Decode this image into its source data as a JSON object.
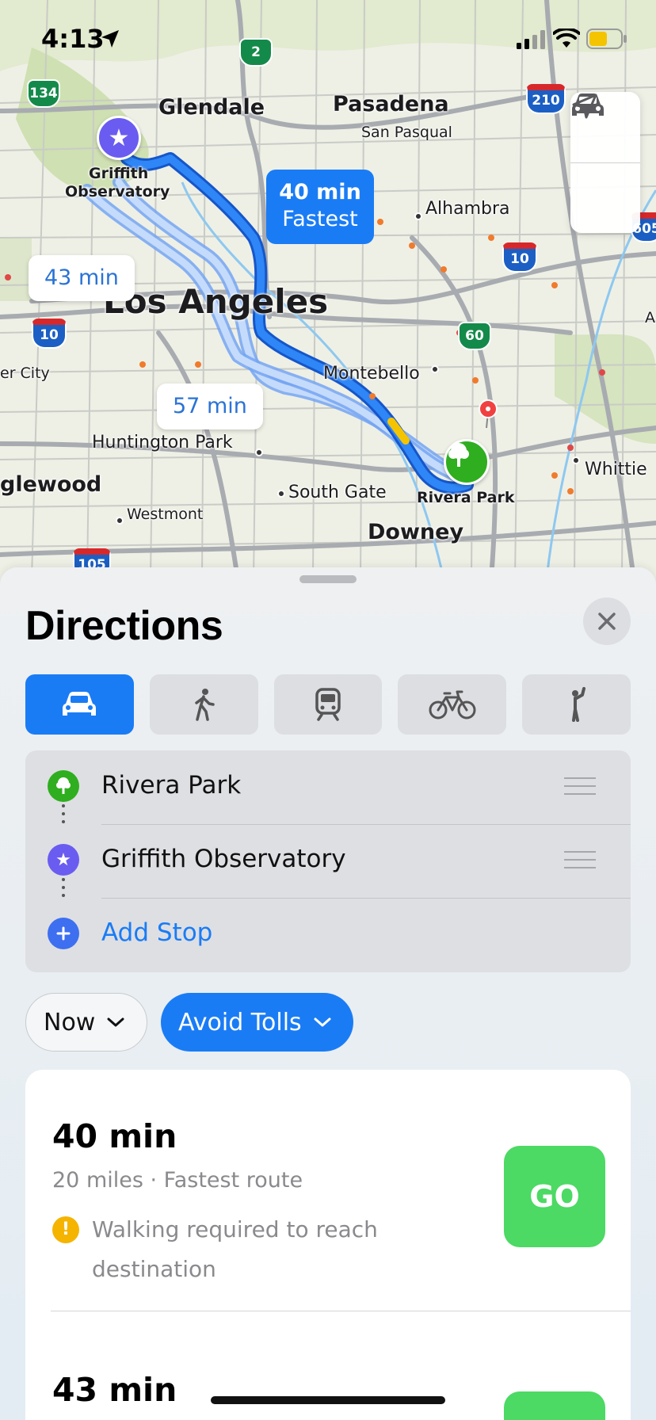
{
  "status_bar": {
    "time": "4:13"
  },
  "map": {
    "cities": {
      "glendale": "Glendale",
      "pasadena": "Pasadena",
      "san_pasqual": "San Pasqual",
      "griffith": "Griffith",
      "observatory": "Observatory",
      "alhambra": "Alhambra",
      "los_angeles": "Los Angeles",
      "montebello": "Montebello",
      "culver_city": "er City",
      "huntington_park": "Huntington Park",
      "inglewood": "glewood",
      "south_gate": "South Gate",
      "rivera_park": "Rivera Park",
      "westmont": "Westmont",
      "downey": "Downey",
      "whittier": "Whittie",
      "edge_a": "A"
    },
    "highways": [
      "134",
      "2",
      "210",
      "10",
      "10",
      "60",
      "605",
      "105"
    ],
    "routes": {
      "fastest_time": "40 min",
      "fastest_label": "Fastest",
      "alt1": "43 min",
      "alt2": "57 min"
    }
  },
  "sheet": {
    "title": "Directions",
    "modes": [
      "drive",
      "walk",
      "transit",
      "cycle",
      "ride-share"
    ],
    "active_mode": "drive",
    "stops": {
      "from": "Rivera Park",
      "to": "Griffith Observatory",
      "add": "Add Stop"
    },
    "options": {
      "time": "Now",
      "avoid": "Avoid Tolls"
    },
    "routes": [
      {
        "duration": "40 min",
        "details": "20 miles · Fastest route",
        "warning": "Walking required to reach destination",
        "go": "GO"
      },
      {
        "duration": "43 min"
      }
    ]
  },
  "colors": {
    "accent": "#1a7cf5",
    "go": "#4cd964",
    "griffith_pin": "#6a5cf0",
    "park_pin": "#2fae1f",
    "warning": "#f5b400"
  }
}
